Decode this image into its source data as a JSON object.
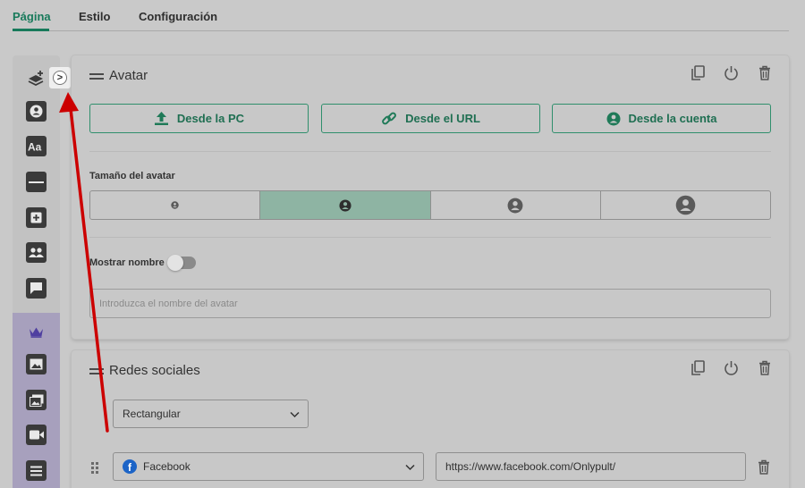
{
  "tabs": [
    {
      "label": "Página",
      "active": true
    },
    {
      "label": "Estilo",
      "active": false
    },
    {
      "label": "Configuración",
      "active": false
    }
  ],
  "toolbar": {
    "tools": [
      "layers-add-icon",
      "avatar-icon",
      "text-icon",
      "divider-icon",
      "add-block-icon",
      "group-icon",
      "chat-icon"
    ],
    "premium_tools": [
      "crown-icon",
      "image-icon",
      "gallery-icon",
      "video-icon",
      "list-icon"
    ],
    "expand_label": ">"
  },
  "avatar_card": {
    "title": "Avatar",
    "sources": [
      "Desde la PC",
      "Desde el URL",
      "Desde la cuenta"
    ],
    "size_label": "Tamaño del avatar",
    "size_options": [
      "xs",
      "s",
      "m",
      "l"
    ],
    "selected_size": 1,
    "show_name_label": "Mostrar nombre",
    "show_name_enabled": false,
    "name_placeholder": "Introduzca el nombre del avatar"
  },
  "social_card": {
    "title": "Redes sociales",
    "style_value": "Rectangular",
    "network_value": "Facebook",
    "url_value": "https://www.facebook.com/Onlypult/"
  },
  "colors": {
    "accent": "#187a5b",
    "selected": "#8eb4a3",
    "premium": "#a7a0bd",
    "arrow": "#cc0000"
  }
}
